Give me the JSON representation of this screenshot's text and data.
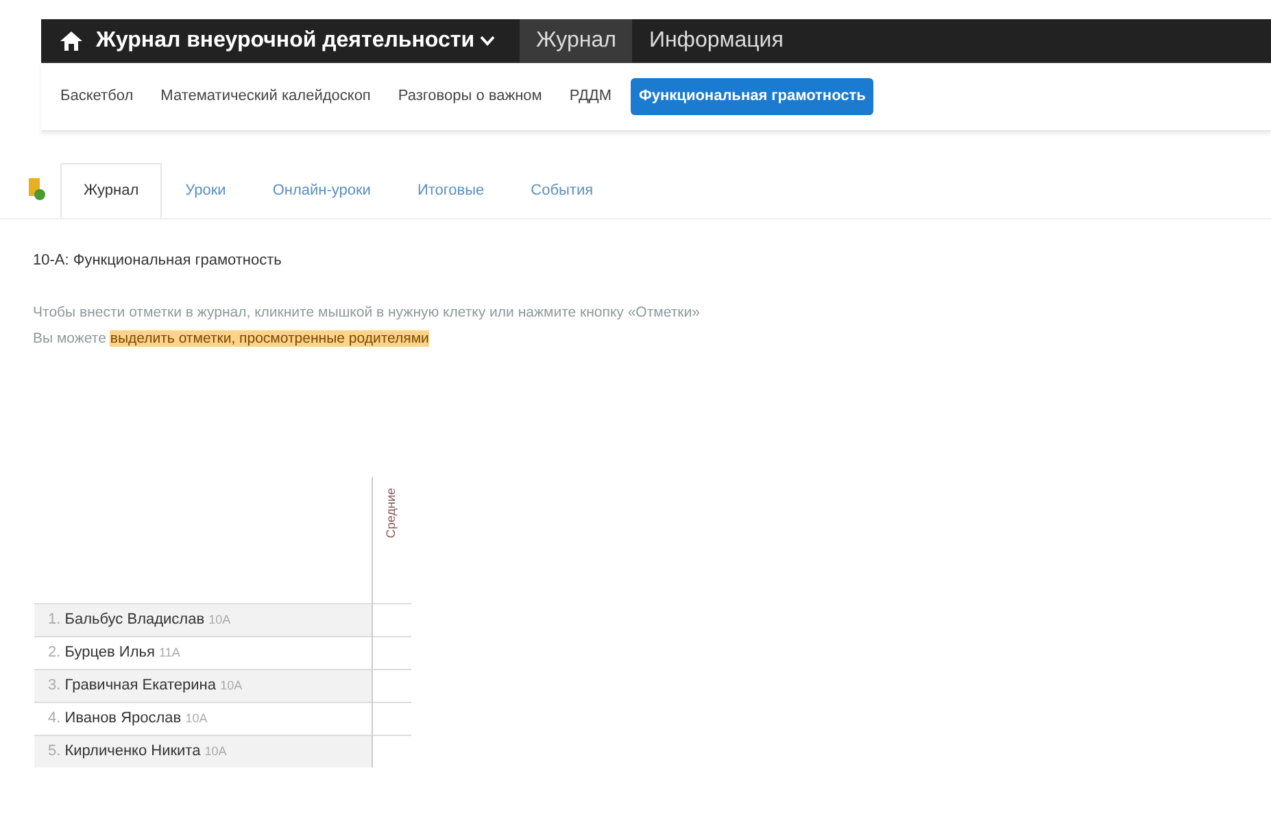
{
  "navbar": {
    "brand": "Журнал внеурочной деятельности",
    "links": [
      {
        "label": "Журнал",
        "selected": true
      },
      {
        "label": "Информация",
        "selected": false
      }
    ]
  },
  "courses": [
    {
      "label": "Баскетбол",
      "selected": false
    },
    {
      "label": "Математический калейдоскоп",
      "selected": false
    },
    {
      "label": "Разговоры о важном",
      "selected": false
    },
    {
      "label": "РДДМ",
      "selected": false
    },
    {
      "label": "Функциональная грамотность",
      "selected": true
    }
  ],
  "tabs": [
    {
      "label": "Журнал",
      "selected": true
    },
    {
      "label": "Уроки",
      "selected": false
    },
    {
      "label": "Онлайн-уроки",
      "selected": false
    },
    {
      "label": "Итоговые",
      "selected": false
    },
    {
      "label": "События",
      "selected": false
    }
  ],
  "heading": "10-А: Функциональная грамотность",
  "hints": [
    "Чтобы внести отметки в журнал, кликните мышкой в нужную клетку или нажмите кнопку «Отметки»"
  ],
  "highlight_hint": {
    "prefix": "Вы можете",
    "link": "выделить отметки, просмотренные родителями"
  },
  "table": {
    "columns": [
      "Средние"
    ],
    "rows": [
      {
        "number": "1.",
        "student": "Бальбус Владислав 10А"
      },
      {
        "number": "2.",
        "student": "Бурцев Илья 11А"
      },
      {
        "number": "3.",
        "student": "Гравичная Екатерина 10А"
      },
      {
        "number": "4.",
        "student": "Иванов Ярослав 10А"
      },
      {
        "number": "5.",
        "student": "Кирличенко Никита 10А"
      }
    ]
  }
}
